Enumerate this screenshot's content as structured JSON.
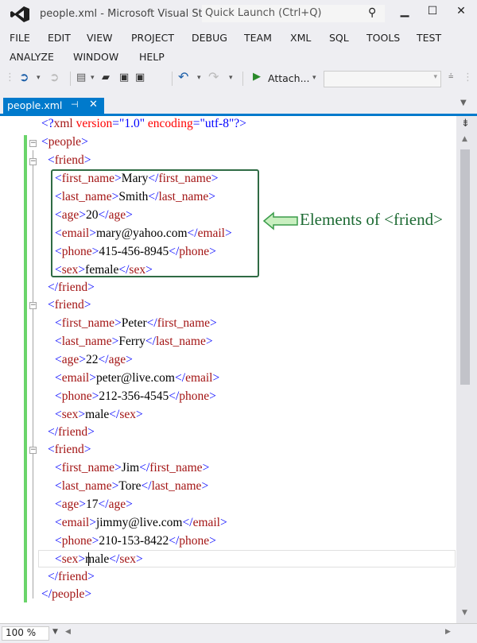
{
  "window": {
    "title": "people.xml - Microsoft Visual St...",
    "quick_launch_placeholder": "Quick Launch (Ctrl+Q)",
    "minimize": "▁",
    "maximize": "☐",
    "close": "✕"
  },
  "menu": {
    "items": [
      "FILE",
      "EDIT",
      "VIEW",
      "PROJECT",
      "DEBUG",
      "TEAM",
      "XML",
      "SQL",
      "TOOLS",
      "TEST",
      "ANALYZE",
      "WINDOW",
      "HELP"
    ]
  },
  "toolbar": {
    "attach_label": "Attach...",
    "combo_value": ""
  },
  "tab": {
    "title": "people.xml",
    "pin": "⊣",
    "close": "✕"
  },
  "editor": {
    "declaration": {
      "open": "<?",
      "name": "xml",
      "attr1": "version",
      "val1": "\"1.0\"",
      "attr2": "encoding",
      "val2": "\"utf-8\"",
      "close": "?>"
    },
    "root_open": "<people>",
    "root_close": "</people>",
    "friends": [
      {
        "fields": [
          {
            "tag": "first_name",
            "value": "Mary"
          },
          {
            "tag": "last_name",
            "value": "Smith"
          },
          {
            "tag": "age",
            "value": "20"
          },
          {
            "tag": "email",
            "value": "mary@yahoo.com"
          },
          {
            "tag": "phone",
            "value": "415-456-8945"
          },
          {
            "tag": "sex",
            "value": "female"
          }
        ]
      },
      {
        "fields": [
          {
            "tag": "first_name",
            "value": "Peter"
          },
          {
            "tag": "last_name",
            "value": "Ferry"
          },
          {
            "tag": "age",
            "value": "22"
          },
          {
            "tag": "email",
            "value": "peter@live.com"
          },
          {
            "tag": "phone",
            "value": "212-356-4545"
          },
          {
            "tag": "sex",
            "value": "male"
          }
        ]
      },
      {
        "fields": [
          {
            "tag": "first_name",
            "value": "Jim"
          },
          {
            "tag": "last_name",
            "value": "Tore"
          },
          {
            "tag": "age",
            "value": "17"
          },
          {
            "tag": "email",
            "value": "jimmy@live.com"
          },
          {
            "tag": "phone",
            "value": "210-153-8422"
          },
          {
            "tag": "sex",
            "value": "male"
          }
        ]
      }
    ],
    "friend_tag": "friend",
    "annotation": "Elements of <friend>"
  },
  "status": {
    "zoom": "100 %"
  },
  "colors": {
    "accent": "#007acc",
    "tag": "#a31515",
    "bracket": "#0000ff",
    "attribute": "#ff0000",
    "annotation": "#1e6b34",
    "change_bar": "#6ad46a"
  }
}
